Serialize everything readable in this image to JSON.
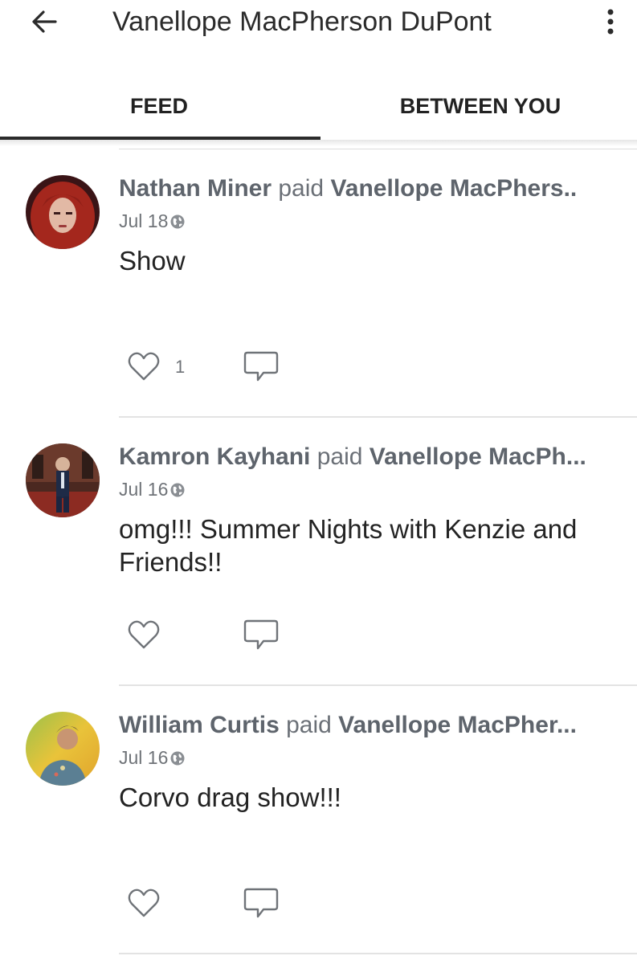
{
  "header": {
    "title": "Vanellope MacPherson DuPont",
    "back_icon": "arrow-left-icon",
    "more_icon": "more-vert-icon"
  },
  "tabs": [
    {
      "label": "FEED",
      "active": true
    },
    {
      "label": "BETWEEN YOU",
      "active": false
    }
  ],
  "stories": [
    {
      "payer": "Nathan Miner",
      "verb": "paid",
      "payee": "Vanellope MacPhers..",
      "date": "Jul 18",
      "privacy_icon": "globe-icon",
      "note": "Show",
      "likes": "1"
    },
    {
      "payer": "Kamron Kayhani",
      "verb": "paid",
      "payee": "Vanellope MacPh...",
      "date": "Jul 16",
      "privacy_icon": "globe-icon",
      "note": "omg!!! Summer Nights with Kenzie and Friends!!",
      "likes": ""
    },
    {
      "payer": "William Curtis",
      "verb": "paid",
      "payee": "Vanellope MacPher...",
      "date": "Jul 16",
      "privacy_icon": "globe-icon",
      "note": "Corvo drag show!!!",
      "likes": ""
    }
  ]
}
